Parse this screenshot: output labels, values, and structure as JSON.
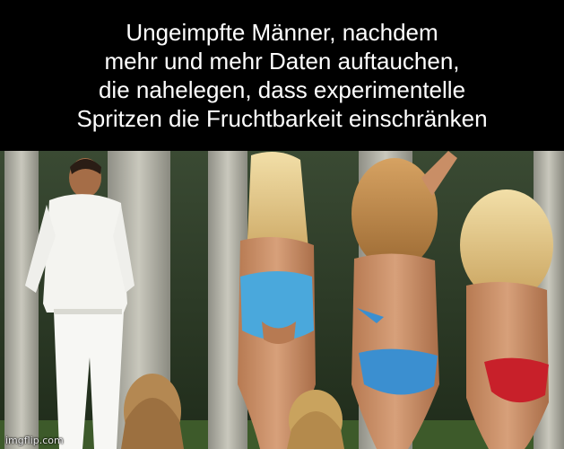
{
  "meme": {
    "caption": "Ungeimpfte Männer, nachdem\nmehr und mehr Daten auftauchen,\ndie nahelegen, dass experimentelle\nSpritzen die Fruchtbarkeit einschränken",
    "watermark": "imgflip.com"
  },
  "colors": {
    "caption_background": "#000000",
    "caption_text": "#ffffff",
    "bikini_blue": "#4aa8dc",
    "bikini_red": "#c8202a",
    "foliage": "#2f4a22"
  }
}
